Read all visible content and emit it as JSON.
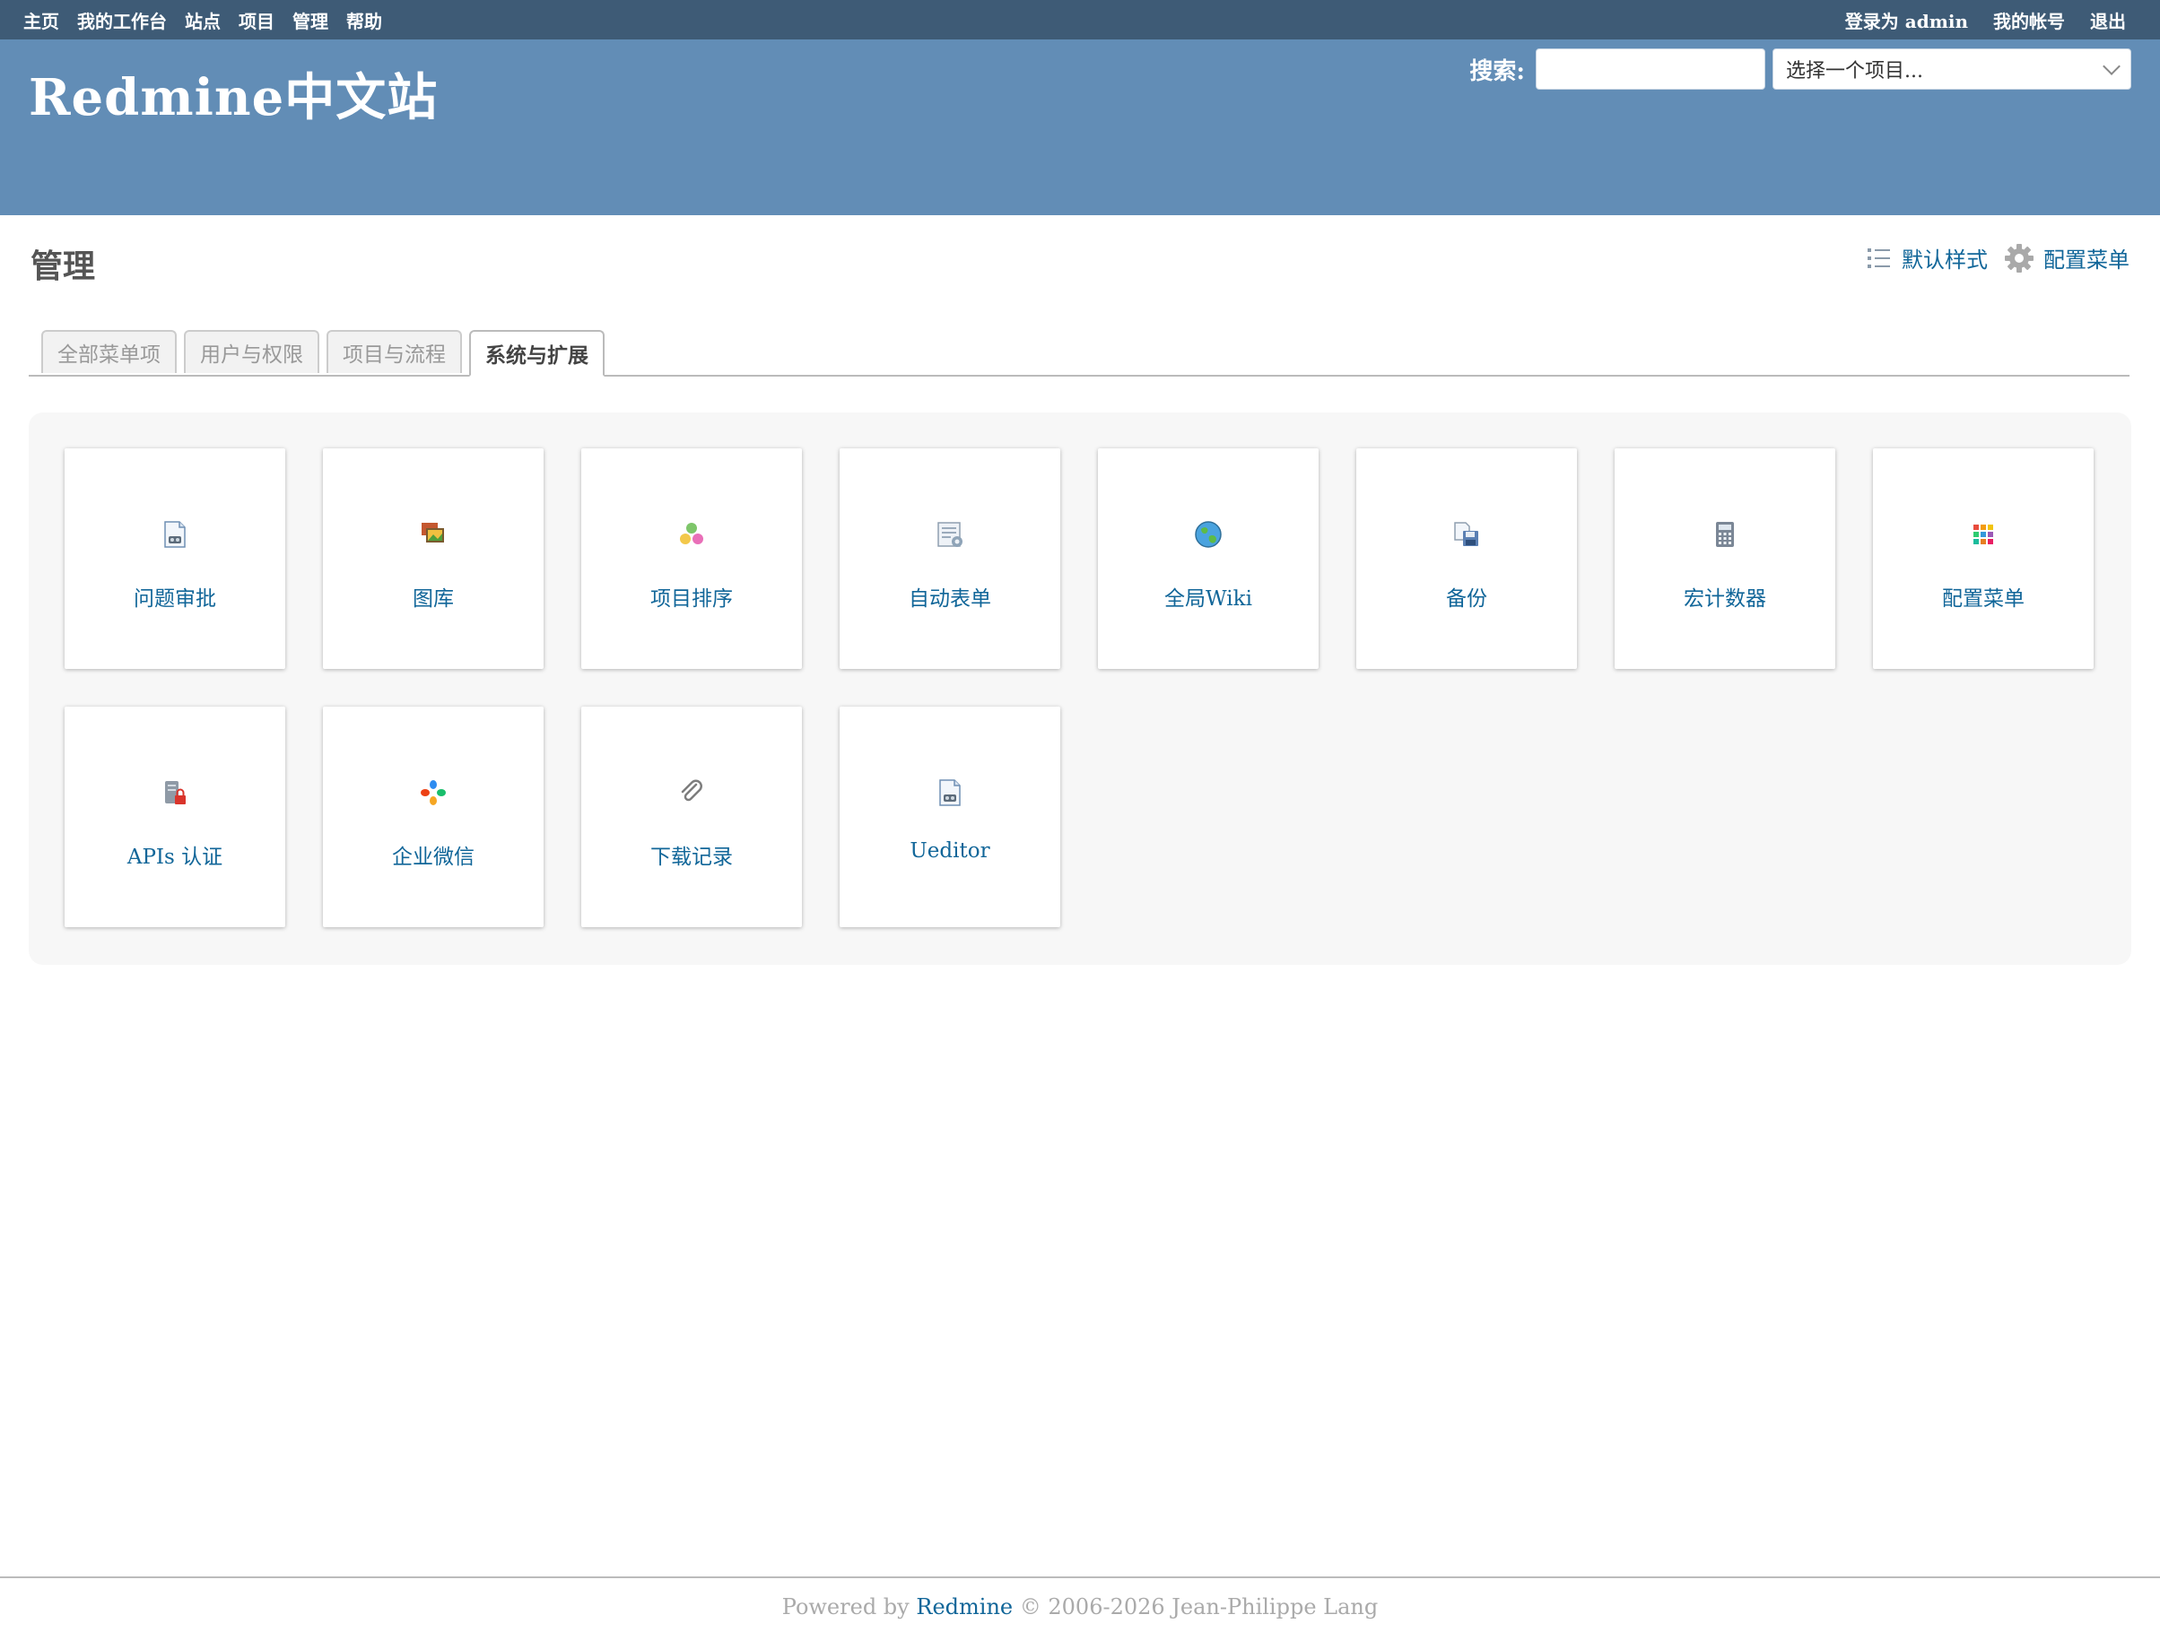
{
  "top_menu": {
    "left": [
      "主页",
      "我的工作台",
      "站点",
      "项目",
      "管理",
      "帮助"
    ],
    "logged_in_prefix": "登录为",
    "user": "admin",
    "account": "我的帐号",
    "logout": "退出"
  },
  "header": {
    "title": "Redmine中文站",
    "search_label": "搜索:",
    "search_value": "",
    "project_jump": "选择一个项目..."
  },
  "page": {
    "title": "管理",
    "contextual": [
      {
        "label": "默认样式",
        "icon": "list-icon"
      },
      {
        "label": "配置菜单",
        "icon": "gear-icon"
      }
    ],
    "tabs": [
      {
        "label": "全部菜单项",
        "selected": false
      },
      {
        "label": "用户与权限",
        "selected": false
      },
      {
        "label": "项目与流程",
        "selected": false
      },
      {
        "label": "系统与扩展",
        "selected": true
      }
    ],
    "cards": [
      {
        "label": "问题审批",
        "icon": "document-icon"
      },
      {
        "label": "图库",
        "icon": "gallery-icon"
      },
      {
        "label": "项目排序",
        "icon": "dots-icon"
      },
      {
        "label": "自动表单",
        "icon": "form-icon"
      },
      {
        "label": "全局Wiki",
        "icon": "globe-icon"
      },
      {
        "label": "备份",
        "icon": "backup-icon"
      },
      {
        "label": "宏计数器",
        "icon": "calculator-icon"
      },
      {
        "label": "配置菜单",
        "icon": "grid-icon"
      },
      {
        "label": "APIs 认证",
        "icon": "server-lock-icon"
      },
      {
        "label": "企业微信",
        "icon": "wechat-icon"
      },
      {
        "label": "下载记录",
        "icon": "paperclip-icon"
      },
      {
        "label": "Ueditor",
        "icon": "document-icon"
      }
    ]
  },
  "footer": {
    "prefix": "Powered by",
    "link": "Redmine",
    "suffix": "© 2006-2026 Jean-Philippe Lang"
  }
}
